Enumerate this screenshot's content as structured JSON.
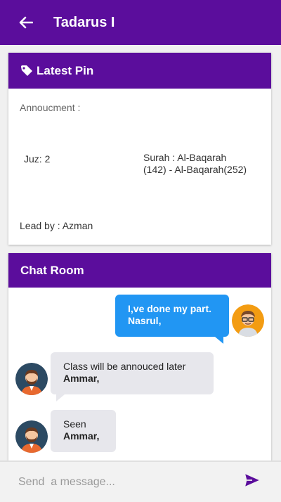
{
  "app": {
    "title": "Tadarus I"
  },
  "pin": {
    "header": "Latest Pin",
    "announcement_label": "Annoucment :",
    "juz": "Juz: 2",
    "surah": "Surah : Al-Baqarah (142) - Al-Baqarah(252)",
    "lead": "Lead by : Azman"
  },
  "chat": {
    "header": "Chat Room",
    "messages": [
      {
        "direction": "out",
        "text": "I,ve done my part.",
        "sender": "Nasrul,"
      },
      {
        "direction": "in",
        "text": "Class will be annouced later",
        "sender": "Ammar,"
      },
      {
        "direction": "in",
        "text": "Seen",
        "sender": "Ammar,"
      }
    ]
  },
  "composer": {
    "placeholder": "Send  a message..."
  },
  "icons": {
    "back": "arrow-left-icon",
    "pin": "tag-icon",
    "send": "send-icon"
  },
  "colors": {
    "primary": "#5b0d9c",
    "outgoing_bubble": "#2196f3",
    "incoming_bubble": "#e7e7ec",
    "send": "#5b0d9c"
  }
}
